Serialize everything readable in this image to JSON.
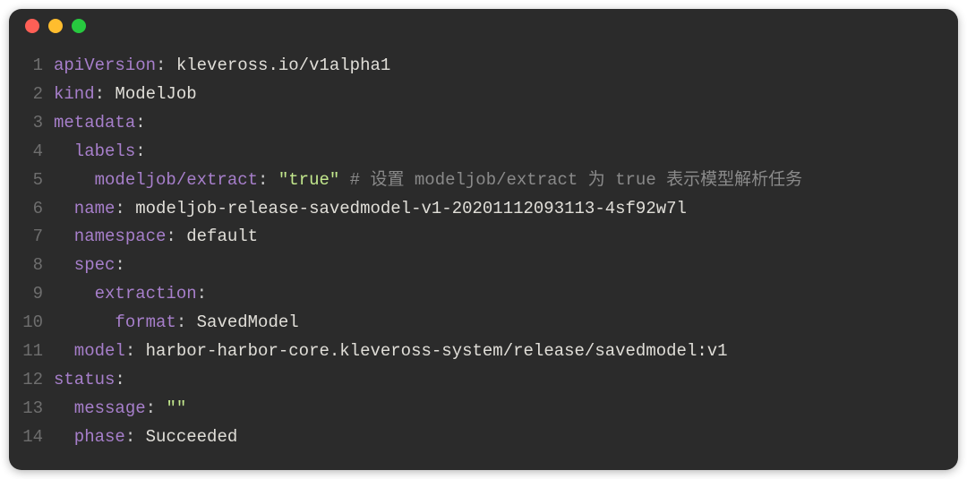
{
  "window": {
    "traffic_lights": [
      "red",
      "yellow",
      "green"
    ]
  },
  "code": {
    "lines": [
      {
        "num": "1",
        "tokens": [
          {
            "cls": "key",
            "text": "apiVersion"
          },
          {
            "cls": "punct",
            "text": ": "
          },
          {
            "cls": "value",
            "text": "kleveross.io/v1alpha1"
          }
        ]
      },
      {
        "num": "2",
        "tokens": [
          {
            "cls": "key",
            "text": "kind"
          },
          {
            "cls": "punct",
            "text": ": "
          },
          {
            "cls": "value",
            "text": "ModelJob"
          }
        ]
      },
      {
        "num": "3",
        "tokens": [
          {
            "cls": "key",
            "text": "metadata"
          },
          {
            "cls": "punct",
            "text": ":"
          }
        ]
      },
      {
        "num": "4",
        "tokens": [
          {
            "cls": "key",
            "text": "  labels"
          },
          {
            "cls": "punct",
            "text": ":"
          }
        ]
      },
      {
        "num": "5",
        "tokens": [
          {
            "cls": "key",
            "text": "    modeljob/extract"
          },
          {
            "cls": "punct",
            "text": ": "
          },
          {
            "cls": "string",
            "text": "\"true\""
          },
          {
            "cls": "comment",
            "text": " # 设置 modeljob/extract 为 true 表示模型解析任务"
          }
        ]
      },
      {
        "num": "6",
        "tokens": [
          {
            "cls": "key",
            "text": "  name"
          },
          {
            "cls": "punct",
            "text": ": "
          },
          {
            "cls": "value",
            "text": "modeljob-release-savedmodel-v1-20201112093113-4sf92w7l"
          }
        ]
      },
      {
        "num": "7",
        "tokens": [
          {
            "cls": "key",
            "text": "  namespace"
          },
          {
            "cls": "punct",
            "text": ": "
          },
          {
            "cls": "value",
            "text": "default"
          }
        ]
      },
      {
        "num": "8",
        "tokens": [
          {
            "cls": "key",
            "text": "  spec"
          },
          {
            "cls": "punct",
            "text": ":"
          }
        ]
      },
      {
        "num": "9",
        "tokens": [
          {
            "cls": "key",
            "text": "    extraction"
          },
          {
            "cls": "punct",
            "text": ":"
          }
        ]
      },
      {
        "num": "10",
        "tokens": [
          {
            "cls": "key",
            "text": "      format"
          },
          {
            "cls": "punct",
            "text": ": "
          },
          {
            "cls": "value",
            "text": "SavedModel"
          }
        ]
      },
      {
        "num": "11",
        "tokens": [
          {
            "cls": "key",
            "text": "  model"
          },
          {
            "cls": "punct",
            "text": ": "
          },
          {
            "cls": "value",
            "text": "harbor-harbor-core.kleveross-system/release/savedmodel:v1"
          }
        ]
      },
      {
        "num": "12",
        "tokens": [
          {
            "cls": "key",
            "text": "status"
          },
          {
            "cls": "punct",
            "text": ":"
          }
        ]
      },
      {
        "num": "13",
        "tokens": [
          {
            "cls": "key",
            "text": "  message"
          },
          {
            "cls": "punct",
            "text": ": "
          },
          {
            "cls": "string",
            "text": "\"\""
          }
        ]
      },
      {
        "num": "14",
        "tokens": [
          {
            "cls": "key",
            "text": "  phase"
          },
          {
            "cls": "punct",
            "text": ": "
          },
          {
            "cls": "value",
            "text": "Succeeded"
          }
        ]
      }
    ]
  }
}
